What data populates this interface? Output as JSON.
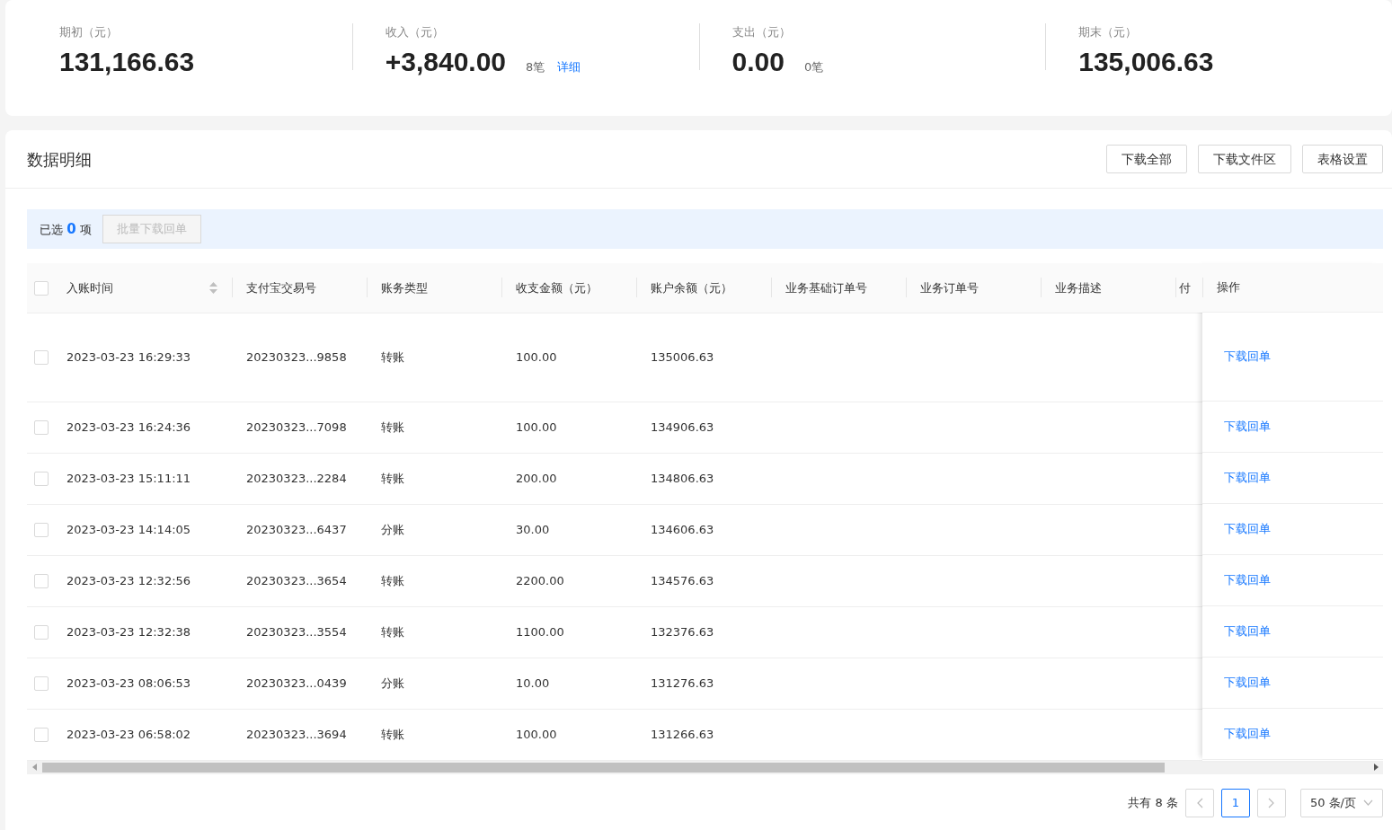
{
  "summary": [
    {
      "label": "期初（元）",
      "amount": "131,166.63"
    },
    {
      "label": "收入（元）",
      "amount": "+3,840.00",
      "count": "8笔",
      "link": "详细"
    },
    {
      "label": "支出（元）",
      "amount": "0.00",
      "count": "0笔"
    },
    {
      "label": "期末（元）",
      "amount": "135,006.63"
    }
  ],
  "detail": {
    "title": "数据明细",
    "buttons": [
      "下载全部",
      "下载文件区",
      "表格设置"
    ],
    "selection": {
      "prefix": "已选",
      "count": "0",
      "suffix": "项",
      "batch_button": {
        "label": "批量下载回单",
        "disabled": true
      }
    },
    "table": {
      "header_checked": false,
      "columns": [
        {
          "label": "入账时间",
          "sortable": true
        },
        {
          "label": "支付宝交易号",
          "sortable": false
        },
        {
          "label": "账务类型",
          "sortable": false
        },
        {
          "label": "收支金额（元）",
          "sortable": false
        },
        {
          "label": "账户余额（元）",
          "sortable": false
        },
        {
          "label": "业务基础订单号",
          "sortable": false
        },
        {
          "label": "业务订单号",
          "sortable": false
        },
        {
          "label": "业务描述",
          "sortable": false
        },
        {
          "label": "付",
          "sortable": false
        }
      ],
      "action_column": "操作",
      "rows": [
        {
          "checked": false,
          "cells": [
            "2023-03-23 16:29:33",
            "20230323...9858",
            "转账",
            "100.00",
            "135006.63"
          ],
          "action": "下载回单"
        },
        {
          "checked": false,
          "cells": [
            "2023-03-23 16:24:36",
            "20230323...7098",
            "转账",
            "100.00",
            "134906.63"
          ],
          "action": "下载回单"
        },
        {
          "checked": false,
          "cells": [
            "2023-03-23 15:11:11",
            "20230323...2284",
            "转账",
            "200.00",
            "134806.63"
          ],
          "action": "下载回单"
        },
        {
          "checked": false,
          "cells": [
            "2023-03-23 14:14:05",
            "20230323...6437",
            "分账",
            "30.00",
            "134606.63"
          ],
          "action": "下载回单"
        },
        {
          "checked": false,
          "cells": [
            "2023-03-23 12:32:56",
            "20230323...3654",
            "转账",
            "2200.00",
            "134576.63"
          ],
          "action": "下载回单"
        },
        {
          "checked": false,
          "cells": [
            "2023-03-23 12:32:38",
            "20230323...3554",
            "转账",
            "1100.00",
            "132376.63"
          ],
          "action": "下载回单"
        },
        {
          "checked": false,
          "cells": [
            "2023-03-23 08:06:53",
            "20230323...0439",
            "分账",
            "10.00",
            "131276.63"
          ],
          "action": "下载回单"
        },
        {
          "checked": false,
          "cells": [
            "2023-03-23 06:58:02",
            "20230323...3694",
            "转账",
            "100.00",
            "131266.63"
          ],
          "action": "下载回单"
        }
      ]
    },
    "pagination": {
      "total": "共有 8 条",
      "prev_disabled": true,
      "pages": [
        {
          "label": "1",
          "selected": true
        }
      ],
      "next_disabled": true,
      "page_size": "50 条/页"
    }
  }
}
